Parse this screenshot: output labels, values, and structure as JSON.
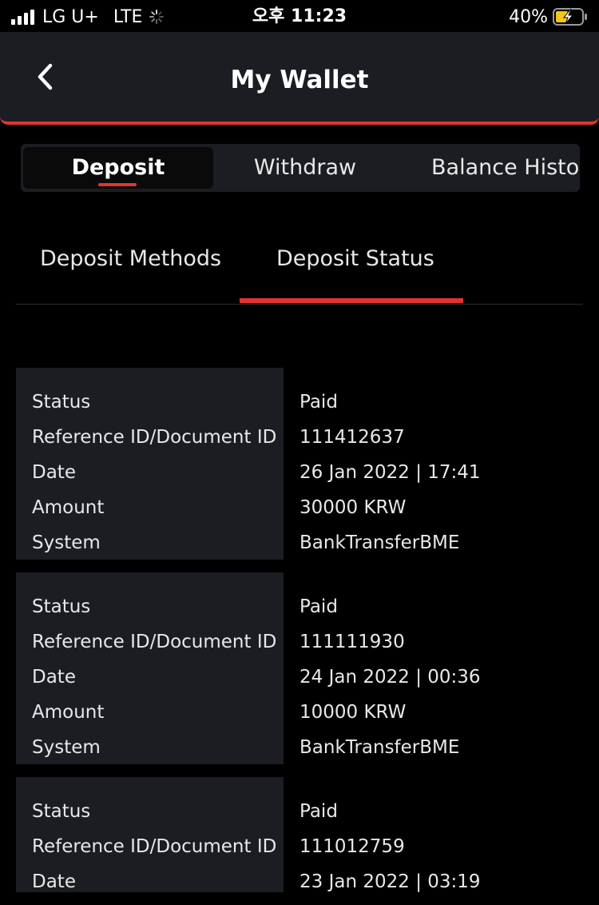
{
  "status_bar": {
    "carrier": "LG U+",
    "network": "LTE",
    "time": "오후 11:23",
    "battery": "40%"
  },
  "header": {
    "title": "My Wallet",
    "back_icon": "chevron-left-icon"
  },
  "main_tabs": {
    "deposit": "Deposit",
    "withdraw": "Withdraw",
    "balance_history": "Balance History"
  },
  "sub_tabs": {
    "methods": "Deposit Methods",
    "status": "Deposit Status"
  },
  "field_labels": {
    "status": "Status",
    "reference": "Reference ID/Document ID",
    "date": "Date",
    "amount": "Amount",
    "system": "System"
  },
  "records": [
    {
      "status": "Paid",
      "reference": "111412637",
      "date": "26 Jan 2022 | 17:41",
      "amount": "30000 KRW",
      "system": "BankTransferBME"
    },
    {
      "status": "Paid",
      "reference": "111111930",
      "date": "24 Jan 2022 | 00:36",
      "amount": "10000 KRW",
      "system": "BankTransferBME"
    },
    {
      "status": "Paid",
      "reference": "111012759",
      "date": "23 Jan 2022 | 03:19",
      "amount": "",
      "system": ""
    }
  ],
  "colors": {
    "accent": "#e3342f",
    "background": "#000000",
    "surface": "#1c1d22",
    "battery_charge": "#f5c518"
  }
}
